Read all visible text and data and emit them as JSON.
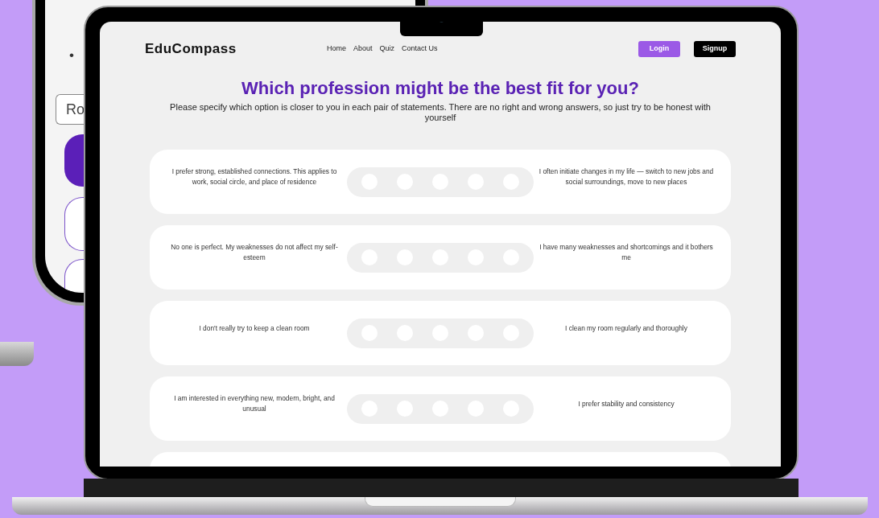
{
  "phone": {
    "bullet": "•",
    "field_value": "Ro"
  },
  "site": {
    "logo": "EduCompass",
    "nav": [
      {
        "label": "Home"
      },
      {
        "label": "About"
      },
      {
        "label": "Quiz"
      },
      {
        "label": "Contact Us"
      }
    ],
    "buttons": [
      {
        "label": "Login",
        "kind": "primary"
      },
      {
        "label": "Signup",
        "kind": "dark"
      }
    ],
    "title": "Which profession might be the best fit for you?",
    "subtitle": "Please specify which option is closer to you in each pair of statements. There are no right and wrong answers, so just try to be honest with yourself",
    "questions": [
      {
        "left": "I prefer strong, established connections. This applies to work, social circle, and place of residence",
        "right": "I often initiate changes in my life — switch to new jobs and social surroundings, move to new places",
        "options": [
          {
            "selected": false
          },
          {
            "selected": false
          },
          {
            "selected": false
          },
          {
            "selected": false
          },
          {
            "selected": false
          }
        ]
      },
      {
        "left": "No one is perfect. My weaknesses do not affect my self-esteem",
        "right": "I have many weaknesses and shortcomings and it bothers me",
        "options": [
          {
            "selected": false
          },
          {
            "selected": false
          },
          {
            "selected": false
          },
          {
            "selected": false
          },
          {
            "selected": false
          }
        ]
      },
      {
        "left": "I don't really try to keep a clean room",
        "right": "I clean my room regularly and thoroughly",
        "options": [
          {
            "selected": false
          },
          {
            "selected": false
          },
          {
            "selected": false
          },
          {
            "selected": false
          },
          {
            "selected": false
          }
        ]
      },
      {
        "left": "I am interested in everything new, modern, bright, and unusual",
        "right": "I prefer stability and consistency",
        "options": [
          {
            "selected": false
          },
          {
            "selected": false
          },
          {
            "selected": false
          },
          {
            "selected": false
          },
          {
            "selected": false
          }
        ]
      }
    ]
  }
}
